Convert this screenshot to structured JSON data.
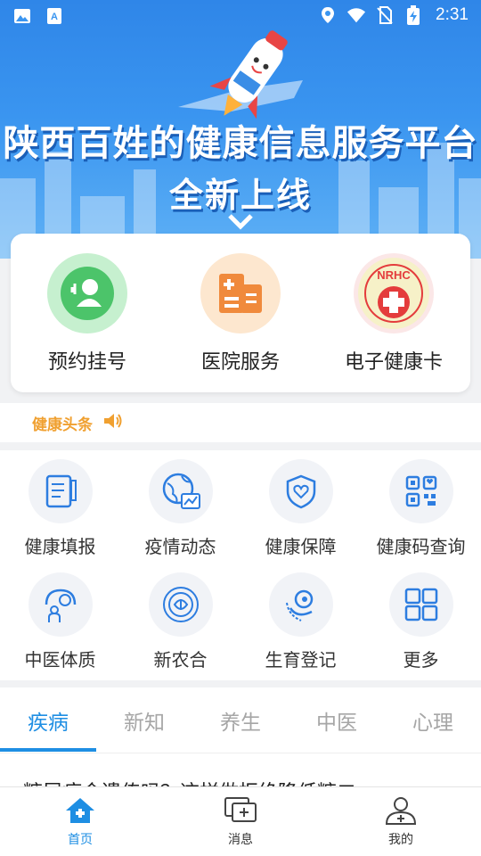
{
  "status_bar": {
    "time": "2:31"
  },
  "banner": {
    "title_line1": "陕西百姓的健康信息服务平台",
    "title_line2": "全新上线"
  },
  "services": [
    {
      "label": "预约挂号",
      "icon": "doctor-icon",
      "color": "#4cc46a"
    },
    {
      "label": "医院服务",
      "icon": "hospital-icon",
      "color": "#f08a3c"
    },
    {
      "label": "电子健康卡",
      "icon": "nrhc-icon",
      "color": "#e43c3c",
      "badge_text": "NRHC"
    }
  ],
  "headline": {
    "label": "健康头条"
  },
  "grid": [
    {
      "label": "健康填报",
      "icon": "form-icon"
    },
    {
      "label": "疫情动态",
      "icon": "globe-icon"
    },
    {
      "label": "健康保障",
      "icon": "shield-heart-icon"
    },
    {
      "label": "健康码查询",
      "icon": "qr-code-icon"
    },
    {
      "label": "中医体质",
      "icon": "tcm-icon"
    },
    {
      "label": "新农合",
      "icon": "insurance-emblem-icon"
    },
    {
      "label": "生育登记",
      "icon": "birth-icon"
    },
    {
      "label": "更多",
      "icon": "more-grid-icon"
    }
  ],
  "tabs": [
    {
      "label": "疾病",
      "active": true
    },
    {
      "label": "新知",
      "active": false
    },
    {
      "label": "养生",
      "active": false
    },
    {
      "label": "中医",
      "active": false
    },
    {
      "label": "心理",
      "active": false
    }
  ],
  "article": {
    "title": "糖尿病会遗传吗？这样做拒绝降低糖二"
  },
  "bottom_nav": [
    {
      "label": "首页",
      "icon": "home-icon",
      "active": true
    },
    {
      "label": "消息",
      "icon": "message-icon",
      "active": false
    },
    {
      "label": "我的",
      "icon": "profile-icon",
      "active": false
    }
  ],
  "colors": {
    "accent": "#1e8ee3",
    "headline": "#f0a030",
    "banner": "#3a95f0"
  }
}
